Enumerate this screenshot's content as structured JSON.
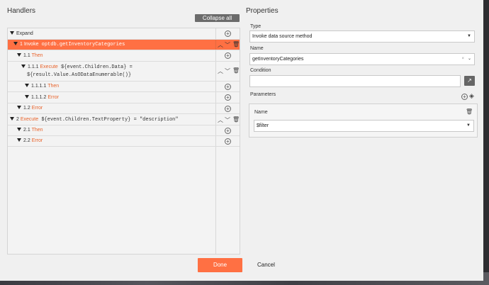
{
  "handlers": {
    "title": "Handlers",
    "collapse_all": "Collapse all",
    "rows": [
      {
        "name": "expand",
        "tri": true,
        "parts": [
          {
            "t": "plain",
            "v": "Expand"
          }
        ]
      },
      {
        "name": "invoke",
        "tri": true,
        "parts": [
          {
            "t": "kw",
            "v": "1 Invoke"
          },
          {
            "t": "mono",
            "v": " optdb.getInventoryCategories"
          }
        ]
      },
      {
        "name": "then-1-1",
        "tri": true,
        "parts": [
          {
            "t": "plain",
            "v": "1.1 "
          },
          {
            "t": "kw",
            "v": "Then"
          }
        ]
      },
      {
        "name": "execute-1-1-1",
        "tri": true,
        "parts": [
          {
            "t": "plain",
            "v": "1.1.1 "
          },
          {
            "t": "kw",
            "v": "Execute"
          },
          {
            "t": "mono",
            "v": " ${event.Children.Data} ="
          }
        ],
        "line2": "${result.Value.AsODataEnumerable()}"
      },
      {
        "name": "then-1-1-1-1",
        "tri": true,
        "parts": [
          {
            "t": "plain",
            "v": "1.1.1.1 "
          },
          {
            "t": "kw",
            "v": "Then"
          }
        ]
      },
      {
        "name": "error-1-1-1-2",
        "tri": true,
        "parts": [
          {
            "t": "plain",
            "v": "1.1.1.2 "
          },
          {
            "t": "kw",
            "v": "Error"
          }
        ]
      },
      {
        "name": "error-1-2",
        "tri": true,
        "parts": [
          {
            "t": "plain",
            "v": "1.2 "
          },
          {
            "t": "kw",
            "v": "Error"
          }
        ]
      },
      {
        "name": "execute-2",
        "tri": true,
        "parts": [
          {
            "t": "plain",
            "v": "2 "
          },
          {
            "t": "kw",
            "v": "Execute"
          },
          {
            "t": "mono",
            "v": " ${event.Children.TextProperty} = \"description\""
          }
        ]
      },
      {
        "name": "then-2-1",
        "tri": true,
        "parts": [
          {
            "t": "plain",
            "v": "2.1 "
          },
          {
            "t": "kw",
            "v": "Then"
          }
        ]
      },
      {
        "name": "error-2-2",
        "tri": true,
        "parts": [
          {
            "t": "plain",
            "v": "2.2 "
          },
          {
            "t": "kw",
            "v": "Error"
          }
        ]
      }
    ]
  },
  "properties": {
    "title": "Properties",
    "type_label": "Type",
    "type_value": "Invoke data source method",
    "name_label": "Name",
    "name_value": "getInventoryCategories",
    "condition_label": "Condition",
    "condition_value": "",
    "parameters_label": "Parameters",
    "param_name_label": "Name",
    "param_value": "$filter"
  },
  "footer": {
    "done": "Done",
    "cancel": "Cancel"
  },
  "colors": {
    "accent": "#ff7043"
  }
}
